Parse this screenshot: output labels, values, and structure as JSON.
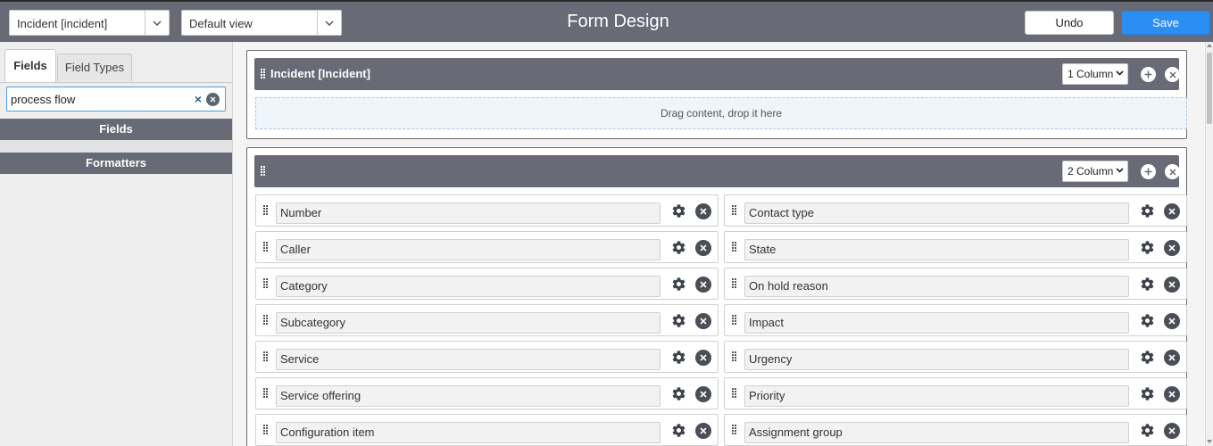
{
  "header": {
    "table_select": "Incident [incident]",
    "view_select": "Default view",
    "title": "Form Design",
    "undo_label": "Undo",
    "save_label": "Save"
  },
  "left_panel": {
    "tabs": [
      {
        "label": "Fields",
        "active": true
      },
      {
        "label": "Field Types",
        "active": false
      }
    ],
    "search": {
      "value": "process flow",
      "clear_symbol": "×"
    },
    "sections": [
      {
        "label": "Fields"
      },
      {
        "label": "Formatters"
      }
    ]
  },
  "canvas": {
    "section1": {
      "title": "Incident [Incident]",
      "columns": "1 Column",
      "drop_hint": "Drag content, drop it here"
    },
    "section2": {
      "title": "",
      "columns": "2 Column",
      "left_fields": [
        "Number",
        "Caller",
        "Category",
        "Subcategory",
        "Service",
        "Service offering",
        "Configuration item"
      ],
      "right_fields": [
        "Contact type",
        "State",
        "On hold reason",
        "Impact",
        "Urgency",
        "Priority",
        "Assignment group"
      ]
    }
  },
  "colors": {
    "header_bg": "#686a75",
    "save_blue": "#2b8ef2"
  },
  "icons": [
    "chevron-down-icon",
    "drag-handle-icon",
    "plus-circle-icon",
    "close-circle-icon",
    "gear-icon",
    "clear-icon"
  ]
}
